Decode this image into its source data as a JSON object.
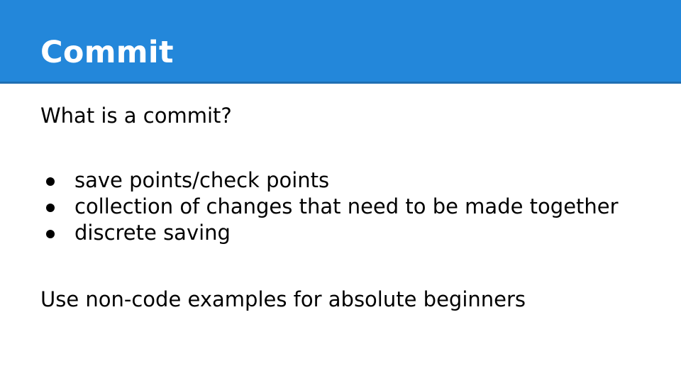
{
  "slide": {
    "title": "Commit",
    "intro": "What is a commit?",
    "bullets": [
      "save points/check points",
      "collection of changes that need to be made together",
      "discrete saving"
    ],
    "closing": "Use non-code examples for absolute beginners"
  },
  "colors": {
    "header_background": "#2387da",
    "header_text": "#ffffff",
    "body_text": "#000000"
  }
}
